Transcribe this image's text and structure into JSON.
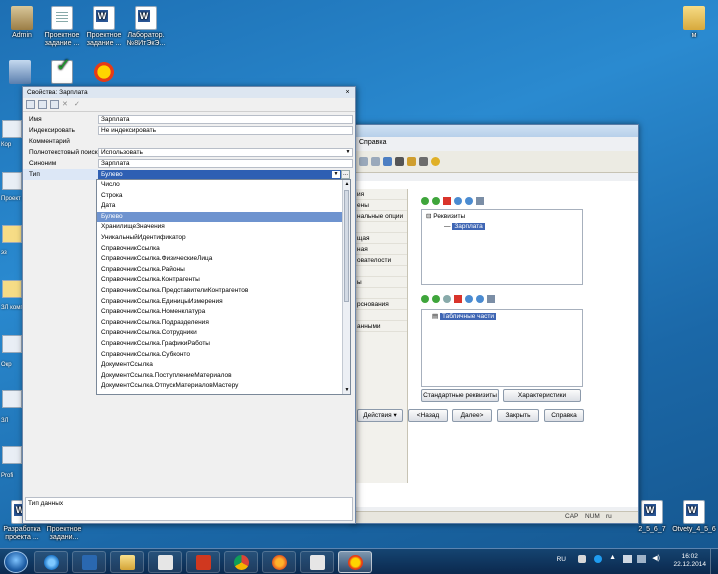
{
  "desktop": {
    "icons_top": [
      {
        "label": "Admin"
      },
      {
        "label": "Проектное задание ..."
      },
      {
        "label": "Проектное задание ..."
      },
      {
        "label": "Лаборатор. №8ИтЭкЭ..."
      }
    ],
    "icon_right": {
      "label": "м"
    },
    "side_labels": [
      "Кор",
      "Проект зана",
      "эз",
      "ЗЛ компь",
      "Окр",
      "ЗЛ",
      "Profi"
    ],
    "bottom_left": [
      {
        "label": "Разработка проекта ..."
      },
      {
        "label": "Проектное задани..."
      }
    ],
    "bottom_right": [
      {
        "label": "2_5_6_7"
      },
      {
        "label": "Otvety_4_5_6"
      }
    ]
  },
  "back_window": {
    "menu": "Справка",
    "left_list": [
      "ия",
      "ены",
      "нальные опции",
      "",
      "щая",
      "ная",
      "ователости",
      "",
      "ы",
      "",
      "рснования",
      "",
      "анными"
    ],
    "reqs_label": "Реквизиты",
    "req_item": "Зарплата",
    "tabparts_label": "Табличные части",
    "btn_std_req": "Стандартные реквизиты",
    "btn_characteristics": "Характеристики",
    "actions": "Действия",
    "back": "<Назад",
    "next": "Далее>",
    "close": "Закрыть",
    "help": "Справка",
    "status_cap": "CAP",
    "status_num": "NUM",
    "status_lang": "ru"
  },
  "props": {
    "title": "Свойства: Зарплата",
    "close_icon": "×",
    "rows": [
      {
        "label": "Имя",
        "value": "Зарплата"
      },
      {
        "label": "Индексировать",
        "value": "Не индексировать"
      },
      {
        "label": "Комментарий",
        "value": ""
      },
      {
        "label": "Полнотекстовый поиск",
        "value": "Использовать"
      },
      {
        "label": "Синоним",
        "value": "Зарплата"
      },
      {
        "label": "Тип",
        "value": "Булево"
      }
    ],
    "dots": "...",
    "type_options": [
      "Число",
      "Строка",
      "Дата",
      "Булево",
      "ХранилищеЗначения",
      "УникальныйИдентификатор",
      "СправочникСсылка",
      "СправочникСсылка.ФизическиеЛица",
      "СправочникСсылка.Районы",
      "СправочникСсылка.Контрагенты",
      "СправочникСсылка.ПредставителиКонтрагентов",
      "СправочникСсылка.ЕдиницыИзмерения",
      "СправочникСсылка.Номенклатура",
      "СправочникСсылка.Подразделения",
      "СправочникСсылка.Сотрудники",
      "СправочникСсылка.ГрафикиРаботы",
      "СправочникСсылка.Субконто",
      "ДокументСсылка",
      "ДокументСсылка.ПоступлениеМатериалов",
      "ДокументСсылка.ОтпускМатериаловМастеру"
    ],
    "selected_option": "Булево",
    "description": "Тип данных"
  },
  "taskbar": {
    "lang": "RU",
    "time": "16:02",
    "date": "22.12.2014"
  }
}
